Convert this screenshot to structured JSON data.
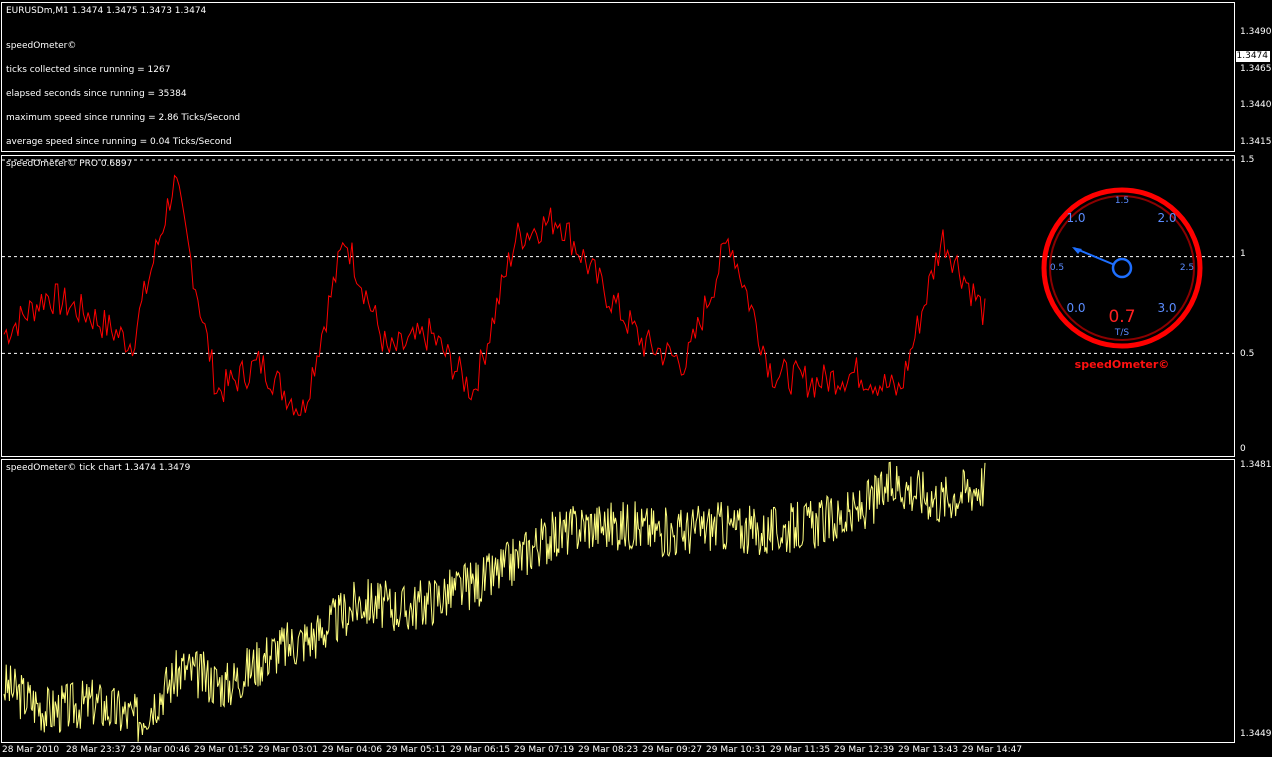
{
  "main_pane": {
    "title": "EURUSDm,M1  1.3474 1.3475 1.3473 1.3474",
    "indicator_name": "speedOmeter©",
    "lines": [
      "ticks collected since running = 1267",
      "elapsed seconds since running = 35384",
      "maximum speed since running = 2.86 Ticks/Second",
      "average speed since running = 0.04 Ticks/Second"
    ],
    "price_scale": [
      "1.3490",
      "1.3465",
      "1.3440",
      "1.3415"
    ],
    "current_price": "1.3474"
  },
  "speed_pane": {
    "title": "speedOmeter© PRO 0.6897",
    "scale": [
      "1.5",
      "1",
      "0.5",
      "0"
    ],
    "line_color": "#ff0000",
    "gauge": {
      "labels": [
        "1.5",
        "1.0",
        "2.0",
        "0.5",
        "2.5",
        "0.0",
        "3.0"
      ],
      "value": "0.7",
      "unit": "T/S",
      "brand": "speedOmeter©",
      "needle_value": 0.7,
      "ring_color": "#ff0000",
      "needle_color": "#1e6fff"
    }
  },
  "tick_pane": {
    "title": "speedOmeter© tick chart 1.3474 1.3479",
    "scale": [
      "1.3481",
      "1.3449"
    ],
    "line_color": "#ffff80"
  },
  "time_axis": [
    "28 Mar 2010",
    "28 Mar 23:37",
    "29 Mar 00:46",
    "29 Mar 01:52",
    "29 Mar 03:01",
    "29 Mar 04:06",
    "29 Mar 05:11",
    "29 Mar 06:15",
    "29 Mar 07:19",
    "29 Mar 08:23",
    "29 Mar 09:27",
    "29 Mar 10:31",
    "29 Mar 11:35",
    "29 Mar 12:39",
    "29 Mar 13:43",
    "29 Mar 14:47"
  ],
  "chart_data": [
    {
      "type": "line",
      "title": "speedOmeter© PRO 0.6897",
      "ylim": [
        0,
        1.5
      ],
      "y_ticks": [
        0,
        0.5,
        1,
        1.5
      ],
      "grid": true,
      "x": [
        "28 Mar 2010",
        "28 Mar 23:37",
        "29 Mar 00:46",
        "29 Mar 01:52",
        "29 Mar 03:01",
        "29 Mar 04:06",
        "29 Mar 05:11",
        "29 Mar 06:15",
        "29 Mar 07:19",
        "29 Mar 08:23",
        "29 Mar 09:27",
        "29 Mar 10:31",
        "29 Mar 11:35",
        "29 Mar 12:39",
        "29 Mar 13:43",
        "29 Mar 14:47"
      ],
      "series": [
        {
          "values": [
            0.6,
            0.8,
            0.7,
            0.55,
            1.4,
            0.3,
            0.45,
            0.2,
            1.1,
            0.5,
            0.6,
            0.3,
            1.1,
            1.2,
            0.85,
            0.55,
            0.45,
            1.1,
            0.4,
            0.35,
            0.4,
            0.3,
            1.1,
            0.7
          ]
        }
      ]
    },
    {
      "type": "line",
      "title": "speedOmeter© tick chart 1.3474 1.3479",
      "ylim": [
        1.3449,
        1.3481
      ],
      "values": [
        1.3455,
        1.3452,
        1.3453,
        1.3451,
        1.3457,
        1.3455,
        1.3459,
        1.3461,
        1.3465,
        1.3464,
        1.3466,
        1.3468,
        1.3472,
        1.3474,
        1.3474,
        1.3473,
        1.3474,
        1.3473,
        1.3474,
        1.3475,
        1.3479,
        1.3477,
        1.3479
      ]
    }
  ]
}
